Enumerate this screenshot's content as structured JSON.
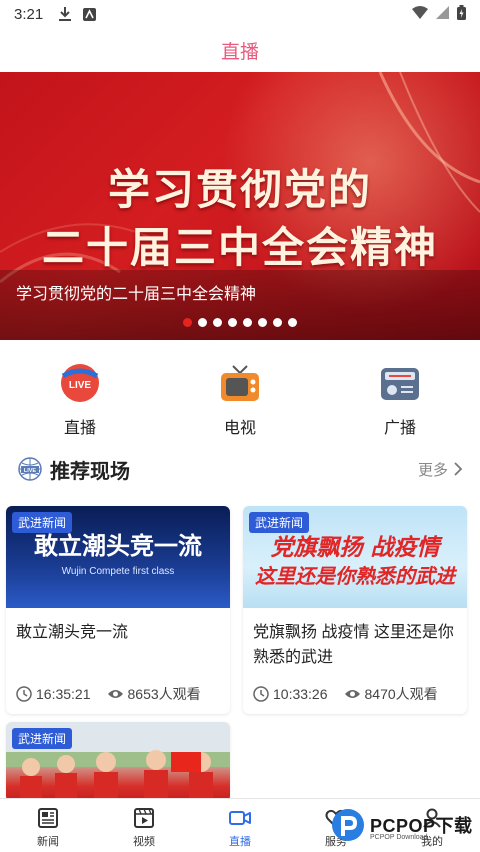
{
  "status_bar": {
    "time": "3:21"
  },
  "header": {
    "title": "直播"
  },
  "banner": {
    "headline_line1": "学习贯彻党的",
    "headline_line2": "二十届三中全会精神",
    "caption": "学习贯彻党的二十届三中全会精神",
    "slide_count": 8,
    "active_slide": 1
  },
  "quick_nav": [
    {
      "label": "直播",
      "icon": "live-icon"
    },
    {
      "label": "电视",
      "icon": "tv-icon"
    },
    {
      "label": "广播",
      "icon": "radio-icon"
    }
  ],
  "section": {
    "title": "推荐现场",
    "more_label": "更多"
  },
  "cards": [
    {
      "tag": "武进新闻",
      "thumb_text": "敢立潮头竞一流",
      "thumb_sub": "Wujin Compete first class",
      "title": "敢立潮头竞一流",
      "time": "16:35:21",
      "views": "8653人观看"
    },
    {
      "tag": "武进新闻",
      "thumb_text": "党旗飘扬 战疫情",
      "thumb_sub": "这里还是你熟悉的武进",
      "title": "党旗飘扬 战疫情 这里还是你熟悉的武进",
      "time": "10:33:26",
      "views": "8470人观看"
    },
    {
      "tag": "武进新闻"
    }
  ],
  "tab_bar": [
    {
      "label": "新闻",
      "icon": "news-icon"
    },
    {
      "label": "视频",
      "icon": "video-icon"
    },
    {
      "label": "直播",
      "icon": "live-camera-icon",
      "active": true
    },
    {
      "label": "服务",
      "icon": "service-icon"
    },
    {
      "label": "我的",
      "icon": "profile-icon"
    }
  ],
  "watermark": {
    "text": "PCPOP下载",
    "sub": "PCPOP Download"
  },
  "colors": {
    "title_pink": "#e85a7e",
    "banner_red": "#c3141b",
    "tag_blue": "#2e5bd6",
    "active_tab_blue": "#2f6ee8"
  }
}
